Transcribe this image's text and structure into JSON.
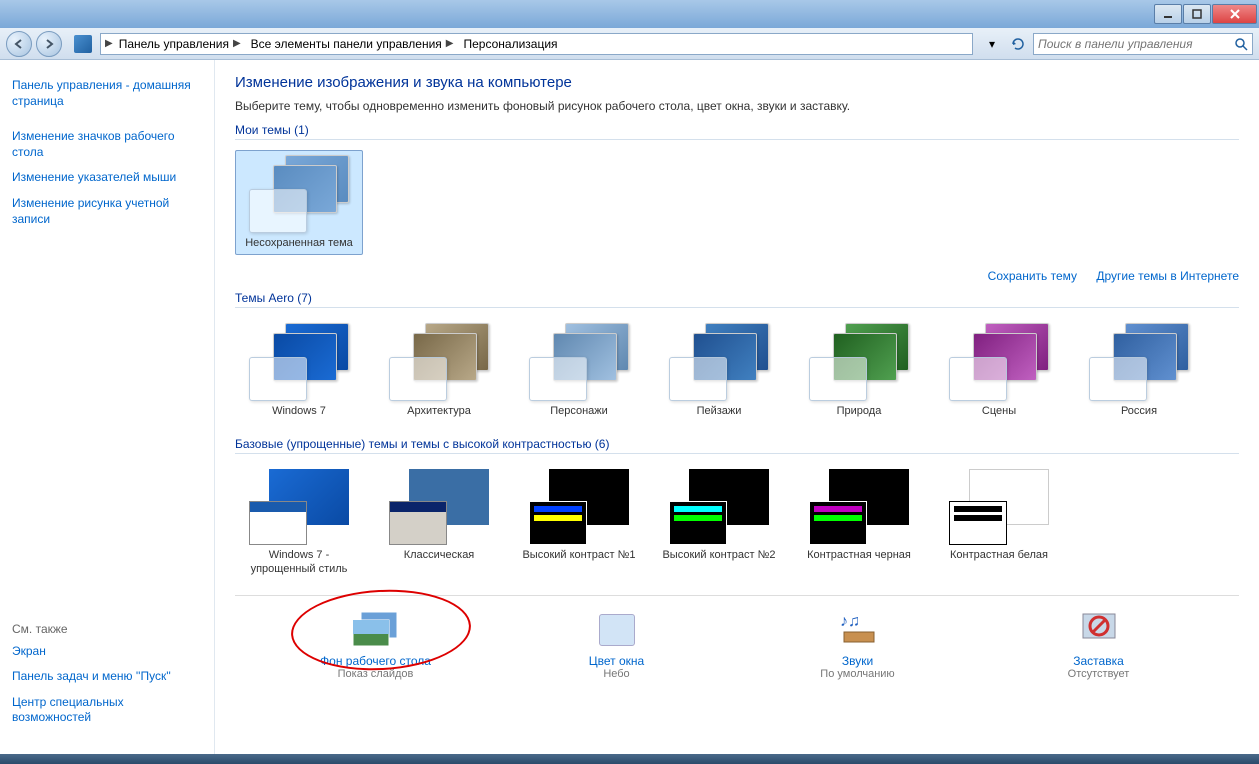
{
  "breadcrumb": {
    "items": [
      "Панель управления",
      "Все элементы панели управления",
      "Персонализация"
    ]
  },
  "search": {
    "placeholder": "Поиск в панели управления"
  },
  "sidebar": {
    "home": "Панель управления - домашняя страница",
    "links": [
      "Изменение значков рабочего стола",
      "Изменение указателей мыши",
      "Изменение рисунка учетной записи"
    ],
    "see_also_hdr": "См. также",
    "see_also": [
      "Экран",
      "Панель задач и меню ''Пуск''",
      "Центр специальных возможностей"
    ]
  },
  "page": {
    "title": "Изменение изображения и звука на компьютере",
    "desc": "Выберите тему, чтобы одновременно изменить фоновый рисунок рабочего стола, цвет окна, звуки и заставку."
  },
  "sections": {
    "my": {
      "label": "Мои темы (1)",
      "save": "Сохранить тему",
      "more": "Другие темы в Интернете"
    },
    "aero": {
      "label": "Темы Aero (7)"
    },
    "basic": {
      "label": "Базовые (упрощенные) темы и темы с высокой контрастностью (6)"
    }
  },
  "themes": {
    "my": [
      {
        "name": "Несохраненная тема",
        "c1": "#7aa8d8",
        "c2": "#5a8cc0"
      }
    ],
    "aero": [
      {
        "name": "Windows 7",
        "c1": "#1a6bd4",
        "c2": "#0a4aa4"
      },
      {
        "name": "Архитектура",
        "c1": "#b8a888",
        "c2": "#786848"
      },
      {
        "name": "Персонажи",
        "c1": "#a0c0e0",
        "c2": "#6088b0"
      },
      {
        "name": "Пейзажи",
        "c1": "#4080c0",
        "c2": "#205090"
      },
      {
        "name": "Природа",
        "c1": "#50a050",
        "c2": "#206020"
      },
      {
        "name": "Сцены",
        "c1": "#c060c0",
        "c2": "#802080"
      },
      {
        "name": "Россия",
        "c1": "#6090d0",
        "c2": "#3060a0"
      }
    ],
    "basic": [
      {
        "name": "Windows 7 - упрощенный стиль",
        "type": "win7b"
      },
      {
        "name": "Классическая",
        "type": "classic"
      },
      {
        "name": "Высокий контраст №1",
        "type": "hc",
        "bg": "#000",
        "b1": "#0040ff",
        "b2": "#ffff00"
      },
      {
        "name": "Высокий контраст №2",
        "type": "hc",
        "bg": "#000",
        "b1": "#00ffff",
        "b2": "#00ff00"
      },
      {
        "name": "Контрастная черная",
        "type": "hc",
        "bg": "#000",
        "b1": "#c000c0",
        "b2": "#00ff00"
      },
      {
        "name": "Контрастная белая",
        "type": "hcw",
        "bg": "#fff",
        "b1": "#000",
        "b2": "#000"
      }
    ]
  },
  "bottom": [
    {
      "title": "Фон рабочего стола",
      "sub": "Показ слайдов",
      "icon": "wallpaper"
    },
    {
      "title": "Цвет окна",
      "sub": "Небо",
      "icon": "color"
    },
    {
      "title": "Звуки",
      "sub": "По умолчанию",
      "icon": "sounds"
    },
    {
      "title": "Заставка",
      "sub": "Отсутствует",
      "icon": "saver"
    }
  ]
}
